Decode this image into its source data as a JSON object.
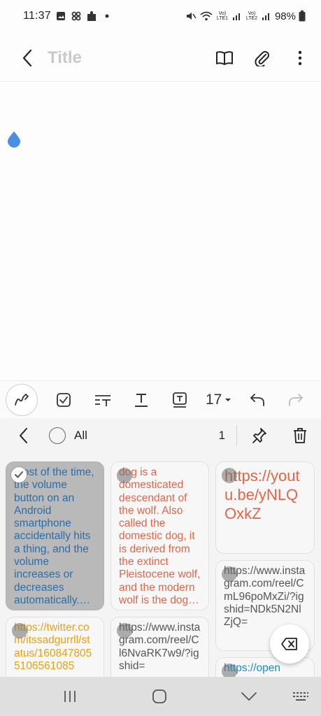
{
  "status_bar": {
    "time": "11:37",
    "battery": "98%",
    "sim1_label": "Vo) LTE1",
    "sim2_label": "Vo) LTE2"
  },
  "header": {
    "title_placeholder": "Title",
    "icons": [
      "back-icon",
      "book-icon",
      "attach-icon",
      "more-icon"
    ]
  },
  "toolbar": {
    "tools": [
      "pen-icon",
      "checkbox-icon",
      "text-style-icon",
      "underline-text-icon",
      "text-box-icon"
    ],
    "font_size": "17"
  },
  "clipboard": {
    "all_label": "All",
    "selected_count": "1",
    "items": [
      {
        "text": "Most of the time, the volume button on an Android smartphone accidentally hits a thing, and the volume increases or decreases automatically. When this happens",
        "color": "#2a6ea8",
        "selected": true
      },
      {
        "text": "https://twitter.com/itssadgurrll/status/1608478055106561085",
        "color": "#e6a116",
        "selected": false
      },
      {
        "text": "dog is a domesticated descendant of the wolf. Also called the domestic dog, it is derived from the extinct Pleistocene wolf, and the modern wolf is the dog's nearest living relative",
        "color": "#e0664a",
        "selected": false
      },
      {
        "text": "https://www.instagram.com/reel/Cl6NvaRK7w9/?igshid=",
        "color": "#555555",
        "selected": false
      },
      {
        "text": "https://youtu.be/yNLQOxkZ",
        "color": "#e0664a",
        "selected": false
      },
      {
        "text": "https://www.instagram.com/reel/CmL96poMxZi/?igshid=NDk5N2NlZjQ=",
        "color": "#555555",
        "selected": false
      },
      {
        "text": "https://open",
        "color": "#1e8bc3",
        "selected": false
      }
    ]
  },
  "colors": {
    "accent_blue": "#4a90e2",
    "selected_card": "#b9b9b9",
    "nav_bar": "#dfdfdf"
  }
}
